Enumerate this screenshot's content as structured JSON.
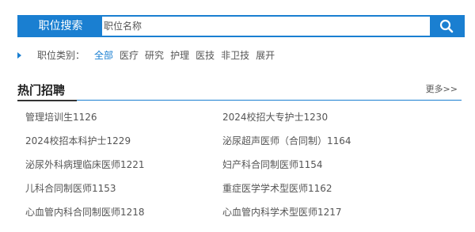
{
  "search": {
    "label": "职位搜索",
    "placeholder": "职位名称",
    "button_icon": "search-icon"
  },
  "categories": {
    "label": "职位类别：",
    "items": [
      "全部",
      "医疗",
      "研究",
      "护理",
      "医技",
      "非卫技",
      "展开"
    ],
    "active_index": 0
  },
  "hot": {
    "title": "热门招聘",
    "more": "更多>>"
  },
  "jobs": [
    "管理培训生1126",
    "2024校招大专护士1230",
    "2024校招本科护士1229",
    "泌尿超声医师（合同制）1164",
    "泌尿外科病理临床医师1221",
    "妇产科合同制医师1154",
    "儿科合同制医师1153",
    "重症医学学术型医师1162",
    "心血管内科合同制医师1218",
    "心血管内科学术型医师1217"
  ],
  "colors": {
    "accent": "#1a7fd1",
    "text": "#555555",
    "heading": "#222222"
  }
}
